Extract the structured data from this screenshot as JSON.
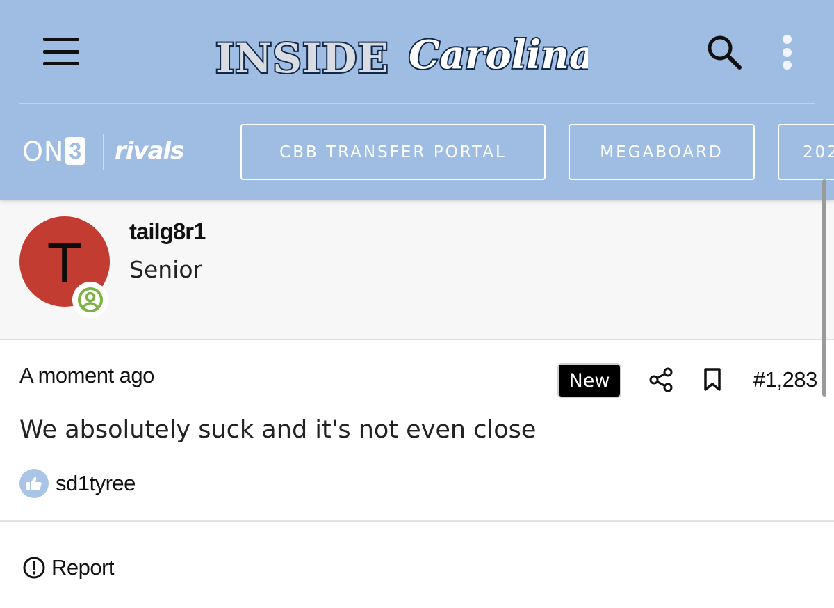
{
  "header": {
    "logo_word": "INSIDE",
    "logo_script": "Carolina",
    "brand_on3_text": "ON",
    "brand_on3_box": "3",
    "brand_rivals": "rivals",
    "nav_buttons": [
      {
        "label": "CBB TRANSFER PORTAL"
      },
      {
        "label": "MEGABOARD"
      },
      {
        "label": "202"
      }
    ],
    "icons": {
      "menu": "hamburger-icon",
      "search": "search-icon",
      "more": "kebab-icon"
    }
  },
  "author": {
    "avatar_letter": "T",
    "username": "tailg8r1",
    "rank": "Senior",
    "status_icon": "online-user-icon"
  },
  "post": {
    "timestamp": "A moment ago",
    "badge": "New",
    "number": "#1,283",
    "body": "We absolutely suck and it's not even close",
    "reaction_user": "sd1tyree"
  },
  "footer": {
    "report_label": "Report"
  },
  "colors": {
    "header_bg": "#9fbde3",
    "avatar_bg": "#c23c32",
    "status_green": "#7cb342",
    "like_bg": "#a9c4e6",
    "logo_navy": "#13294b"
  }
}
